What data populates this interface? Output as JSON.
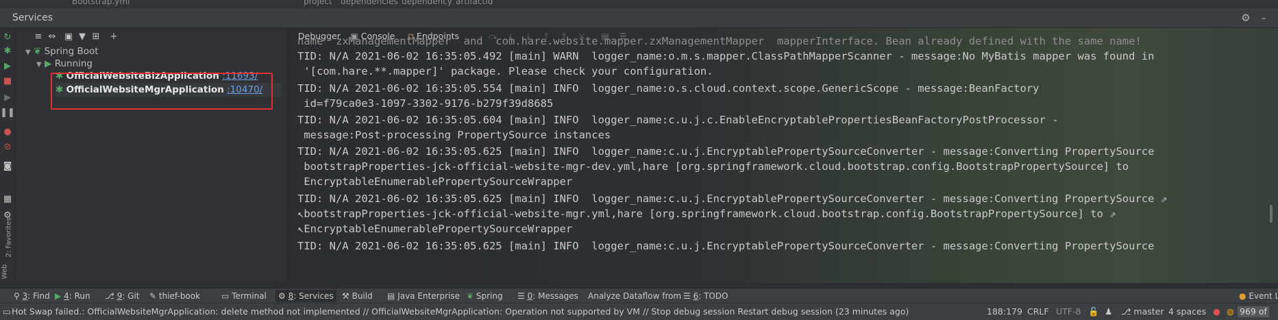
{
  "top_strip": {
    "file": "Bootstrap.yml",
    "breadcrumb": [
      "project",
      "dependencies",
      "dependency",
      "artifactId"
    ]
  },
  "services": {
    "title": "Services"
  },
  "tree": {
    "root": "Spring Boot",
    "group": "Running",
    "apps": [
      {
        "name": "OfficialWebsiteBizApplication",
        "port": ":11693/"
      },
      {
        "name": "OfficialWebsiteMgrApplication",
        "port": ":10470/"
      }
    ]
  },
  "console_tabs": {
    "debugger": "Debugger",
    "console": "Console",
    "endpoints": "Endpoints"
  },
  "log": [
    "name  zxManagementMapper  and  com.hare.website.mapper.zxManagementMapper  mapperInterface. Bean already defined with the same name!",
    "TID: N/A 2021-06-02 16:35:05.492 [main] WARN  logger_name:o.m.s.mapper.ClassPathMapperScanner - message:No MyBatis mapper was found in",
    " '[com.hare.**.mapper]' package. Please check your configuration.",
    "TID: N/A 2021-06-02 16:35:05.554 [main] INFO  logger_name:o.s.cloud.context.scope.GenericScope - message:BeanFactory",
    " id=f79ca0e3-1097-3302-9176-b279f39d8685",
    "TID: N/A 2021-06-02 16:35:05.604 [main] INFO  logger_name:c.u.j.c.EnableEncryptablePropertiesBeanFactoryPostProcessor -",
    " message:Post-processing PropertySource instances",
    "TID: N/A 2021-06-02 16:35:05.625 [main] INFO  logger_name:c.u.j.EncryptablePropertySourceConverter - message:Converting PropertySource",
    " bootstrapProperties-jck-official-website-mgr-dev.yml,hare [org.springframework.cloud.bootstrap.config.BootstrapPropertySource] to",
    " EncryptableEnumerablePropertySourceWrapper",
    "TID: N/A 2021-06-02 16:35:05.625 [main] INFO  logger_name:c.u.j.EncryptablePropertySourceConverter - message:Converting PropertySource ⇗",
    "↖bootstrapProperties-jck-official-website-mgr.yml,hare [org.springframework.cloud.bootstrap.config.BootstrapPropertySource] to ⇗",
    "↖EncryptableEnumerablePropertySourceWrapper",
    "TID: N/A 2021-06-02 16:35:05.625 [main] INFO  logger_name:c.u.j.EncryptablePropertySourceConverter - message:Converting PropertySource"
  ],
  "tool_windows": {
    "find": {
      "num": "3",
      "label": ": Find"
    },
    "run": {
      "num": "4",
      "label": ": Run"
    },
    "git": {
      "num": "9",
      "label": ": Git"
    },
    "thief": "thief-book",
    "terminal": "Terminal",
    "services": {
      "num": "8",
      "label": ": Services"
    },
    "build": "Build",
    "java_ee": "Java Enterprise",
    "spring": "Spring",
    "messages": {
      "num": "0",
      "label": ": Messages"
    },
    "dataflow": "Analyze Dataflow from",
    "todo": {
      "num": "6",
      "label": ": TODO"
    },
    "event_log": "Event L"
  },
  "side_labels": {
    "favorites": "2: Favorites",
    "web": "Web"
  },
  "status": {
    "message": "Hot Swap failed.: OfficialWebsiteMgrApplication: delete method not implemented // OfficialWebsiteMgrApplication: Operation not supported by VM // Stop debug session    Restart debug session (23 minutes ago)",
    "position": "188:179",
    "line_sep": "CRLF",
    "encoding": "UTF-8",
    "branch": "master",
    "indent": "4 spaces",
    "memory": "969 of"
  },
  "colors": {
    "highlight": "#e03030",
    "running": "#59a869",
    "link": "#6fa1e6"
  },
  "icons": [
    "rerun-icon",
    "expand-all-icon",
    "collapse-all-icon",
    "group-icon",
    "filter-icon",
    "new-service-icon",
    "add-icon",
    "gear-icon",
    "minimize-icon",
    "bug-icon",
    "run-icon",
    "stop-icon",
    "pause-icon",
    "camera-icon",
    "layout-icon",
    "settings-icon"
  ]
}
